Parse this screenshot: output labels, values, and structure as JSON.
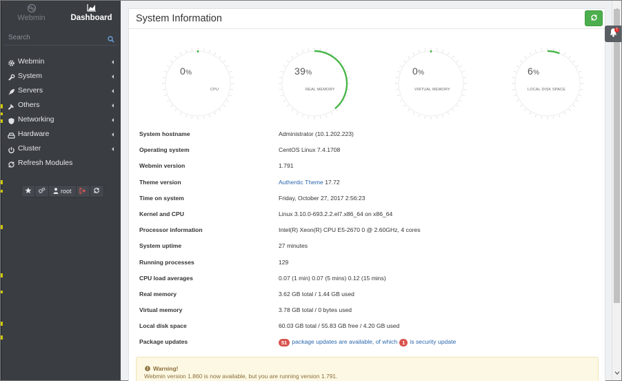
{
  "sidebar": {
    "tabs": {
      "webmin": "Webmin",
      "dashboard": "Dashboard"
    },
    "search_placeholder": "Search",
    "items": [
      {
        "label": "Webmin",
        "icon": "gear-icon"
      },
      {
        "label": "System",
        "icon": "wrench-icon"
      },
      {
        "label": "Servers",
        "icon": "rocket-icon"
      },
      {
        "label": "Others",
        "icon": "tools-icon"
      },
      {
        "label": "Networking",
        "icon": "shield-icon"
      },
      {
        "label": "Hardware",
        "icon": "hdd-icon"
      },
      {
        "label": "Cluster",
        "icon": "power-icon"
      },
      {
        "label": "Refresh Modules",
        "icon": "refresh-icon"
      }
    ],
    "user": "root"
  },
  "main": {
    "title": "System Information",
    "gauges": [
      {
        "value": "0",
        "unit": "%",
        "label": "CPU",
        "percent": 0
      },
      {
        "value": "39",
        "unit": "%",
        "label": "REAL MEMORY",
        "percent": 39
      },
      {
        "value": "0",
        "unit": "%",
        "label": "VIRTUAL MEMORY",
        "percent": 0
      },
      {
        "value": "6",
        "unit": "%",
        "label": "LOCAL DISK SPACE",
        "percent": 6
      }
    ],
    "info": {
      "hostname": {
        "label": "System hostname",
        "value": "Administrator (10.1.202.223)"
      },
      "os": {
        "label": "Operating system",
        "value": "CentOS Linux 7.4.1708"
      },
      "webmin_version": {
        "label": "Webmin version",
        "value": "1.791"
      },
      "theme_version": {
        "label": "Theme version",
        "link": "Authentic Theme",
        "value": "17.72"
      },
      "time": {
        "label": "Time on system",
        "value": "Friday, October 27, 2017 2:56:23"
      },
      "kernel": {
        "label": "Kernel and CPU",
        "value": "Linux 3.10.0-693.2.2.el7.x86_64 on x86_64"
      },
      "processor": {
        "label": "Processor information",
        "value": "Intel(R) Xeon(R) CPU E5-2670 0 @ 2.60GHz, 4 cores"
      },
      "uptime": {
        "label": "System uptime",
        "value": "27 minutes"
      },
      "processes": {
        "label": "Running processes",
        "value": "129"
      },
      "load": {
        "label": "CPU load averages",
        "value": "0.07 (1 min) 0.07 (5 mins) 0.12 (15 mins)"
      },
      "real_memory": {
        "label": "Real memory",
        "value": "3.62 GB total / 1.44 GB used"
      },
      "virtual_memory": {
        "label": "Virtual memory",
        "value": "3.78 GB total / 0 bytes used"
      },
      "disk": {
        "label": "Local disk space",
        "value": "60.03 GB total / 55.83 GB free / 4.20 GB used"
      },
      "updates": {
        "label": "Package updates",
        "count": "51",
        "text1": "package updates are available, of which",
        "security_count": "1",
        "text2": "is security update"
      }
    },
    "warning": {
      "title": "Warning!",
      "text": "Webmin version 1.860 is now available, but you are running version 1.791."
    }
  },
  "colors": {
    "sidebar": "#3a3d42",
    "gauge_fill": "#48b648",
    "refresh_button": "#4cae4c",
    "link": "#2a66ad",
    "badge": "#d9534f"
  }
}
